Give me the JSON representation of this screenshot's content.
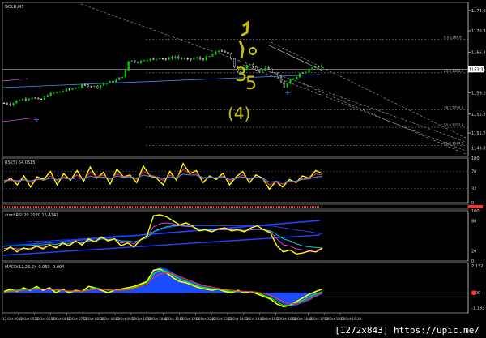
{
  "chart_data": [
    {
      "type": "candlestick",
      "title": "GOLD,M5",
      "y_ticks": [
        "1174.05",
        "1170.35",
        "1166.45",
        "1163.37",
        "1159.10",
        "1155.20",
        "1151.75",
        "1149.05"
      ],
      "ylim": [
        1147.5,
        1175.5
      ],
      "current_price": "1163.37",
      "levels": [
        {
          "label": "0.0 1168.8",
          "value": 1168.8
        },
        {
          "label": "23.6 1162.7",
          "value": 1162.7
        },
        {
          "label": "38.2 1156.0",
          "value": 1156.0
        },
        {
          "label": "50.0 1152.8",
          "value": 1152.8
        },
        {
          "label": "61.8 1149.5",
          "value": 1149.5
        }
      ],
      "price_path": [
        [
          0,
          1157.2
        ],
        [
          5,
          1157.0
        ],
        [
          10,
          1157.8
        ],
        [
          15,
          1158.0
        ],
        [
          20,
          1158.3
        ],
        [
          25,
          1157.6
        ],
        [
          30,
          1158.6
        ],
        [
          35,
          1159.0
        ],
        [
          40,
          1159.3
        ],
        [
          45,
          1159.6
        ],
        [
          50,
          1160.0
        ],
        [
          55,
          1160.3
        ],
        [
          60,
          1160.5
        ],
        [
          65,
          1160.1
        ],
        [
          70,
          1160.7
        ],
        [
          75,
          1161.0
        ],
        [
          80,
          1161.4
        ],
        [
          85,
          1162.4
        ],
        [
          88,
          1164.8
        ],
        [
          91,
          1165.0
        ],
        [
          95,
          1164.6
        ],
        [
          100,
          1165.3
        ],
        [
          105,
          1165.0
        ],
        [
          110,
          1165.5
        ],
        [
          115,
          1165.1
        ],
        [
          120,
          1165.7
        ],
        [
          125,
          1165.3
        ],
        [
          130,
          1165.0
        ],
        [
          135,
          1165.4
        ],
        [
          140,
          1165.2
        ],
        [
          145,
          1165.6
        ],
        [
          150,
          1166.4
        ],
        [
          153,
          1167.0
        ],
        [
          156,
          1166.3
        ],
        [
          160,
          1165.7
        ],
        [
          163,
          1163.8
        ],
        [
          166,
          1162.6
        ],
        [
          170,
          1163.3
        ],
        [
          173,
          1164.5
        ],
        [
          176,
          1164.0
        ],
        [
          180,
          1163.0
        ],
        [
          185,
          1163.4
        ],
        [
          190,
          1162.9
        ],
        [
          195,
          1161.7
        ],
        [
          198,
          1160.0
        ],
        [
          202,
          1161.2
        ],
        [
          206,
          1162.0
        ],
        [
          210,
          1162.6
        ],
        [
          215,
          1163.2
        ],
        [
          220,
          1163.6
        ],
        [
          225,
          1164.2
        ]
      ],
      "time_labels": [
        "12 Oct 2015",
        "12 Oct 05:20",
        "12 Oct 06:00",
        "12 Oct 06:40",
        "12 Oct 07:20",
        "12 Oct 08:00",
        "12 Oct 08:40",
        "12 Oct 09:20",
        "12 Oct 10:00",
        "12 Oct 10:40",
        "12 Oct 11:20",
        "12 Oct 12:00",
        "12 Oct 12:40",
        "12 Oct 13:20",
        "12 Oct 14:00",
        "12 Oct 14:40",
        "12 Oct 15:20",
        "12 Oct 16:00",
        "12 Oct 16:40",
        "12 Oct 17:20",
        "12 Oct 18:00",
        "12 Oct 19:20"
      ],
      "annotation_glyphs": [
        "3",
        "5",
        "4"
      ]
    },
    {
      "type": "line",
      "title": "RSI(5) 64.0615",
      "y_ticks": [
        "100",
        "70",
        "32",
        "0"
      ],
      "ylim": [
        0,
        100
      ],
      "series": [
        {
          "color": "#ffff00",
          "values": [
            45,
            55,
            40,
            60,
            35,
            58,
            52,
            70,
            40,
            65,
            50,
            72,
            48,
            80,
            55,
            68,
            42,
            75,
            58,
            62,
            45,
            82,
            60,
            55,
            40,
            70,
            50,
            88,
            65,
            72,
            45,
            60,
            52,
            66,
            40,
            58,
            70,
            45,
            62,
            55,
            30,
            48,
            35,
            52,
            45,
            60,
            55,
            72,
            65
          ]
        },
        {
          "color": "#ff3333",
          "values": [
            48,
            50,
            47,
            52,
            46,
            55,
            50,
            60,
            50,
            58,
            52,
            62,
            52,
            68,
            58,
            62,
            52,
            65,
            58,
            60,
            52,
            70,
            62,
            58,
            50,
            62,
            55,
            74,
            66,
            66,
            54,
            58,
            55,
            60,
            48,
            56,
            62,
            52,
            58,
            54,
            40,
            46,
            42,
            48,
            46,
            54,
            55,
            64,
            62
          ]
        },
        {
          "color": "#4a90ff",
          "values": [
            50,
            51,
            49,
            51,
            49,
            52,
            51,
            55,
            52,
            55,
            53,
            56,
            53,
            60,
            56,
            58,
            54,
            60,
            57,
            58,
            55,
            62,
            59,
            58,
            54,
            58,
            56,
            64,
            62,
            62,
            56,
            57,
            56,
            58,
            52,
            55,
            58,
            54,
            56,
            55,
            46,
            48,
            46,
            48,
            48,
            52,
            53,
            58,
            59
          ]
        }
      ]
    },
    {
      "type": "line",
      "title": "stochRSI 20.2020 15.4247",
      "y_ticks": [
        "100",
        "80",
        "20",
        "0"
      ],
      "ylim": [
        0,
        100
      ],
      "series": [
        {
          "color": "#ffff00",
          "values": [
            20,
            28,
            18,
            26,
            22,
            30,
            24,
            32,
            26,
            36,
            30,
            40,
            32,
            44,
            38,
            48,
            40,
            44,
            30,
            36,
            28,
            42,
            50,
            90,
            92,
            88,
            80,
            72,
            76,
            70,
            60,
            62,
            58,
            64,
            66,
            60,
            62,
            58,
            66,
            70,
            62,
            56,
            30,
            18,
            22,
            14,
            16,
            20,
            18,
            26
          ]
        },
        {
          "color": "#ff44ff",
          "values": [
            25,
            26,
            24,
            25,
            25,
            28,
            27,
            30,
            28,
            34,
            32,
            38,
            35,
            42,
            40,
            46,
            42,
            44,
            36,
            38,
            34,
            42,
            48,
            68,
            74,
            76,
            74,
            70,
            70,
            68,
            62,
            62,
            60,
            62,
            62,
            62,
            62,
            60,
            62,
            64,
            62,
            58,
            44,
            32,
            30,
            24,
            22,
            22,
            22,
            24
          ]
        },
        {
          "color": "#00e5e5",
          "values": [
            30,
            30,
            30,
            30,
            31,
            32,
            32,
            34,
            33,
            36,
            35,
            38,
            37,
            40,
            40,
            44,
            43,
            44,
            40,
            40,
            38,
            42,
            46,
            58,
            64,
            68,
            70,
            70,
            69,
            68,
            64,
            63,
            62,
            62,
            62,
            62,
            62,
            61,
            62,
            63,
            62,
            60,
            52,
            44,
            40,
            34,
            30,
            28,
            27,
            26
          ]
        },
        {
          "color": "#2244ff",
          "values": [
            38,
            38,
            38,
            38,
            39,
            39,
            40,
            40,
            41,
            42,
            42,
            43,
            44,
            45,
            46,
            47,
            48,
            49,
            50,
            50,
            51,
            52,
            54,
            58,
            62,
            66,
            68,
            70,
            70,
            70,
            70,
            70,
            70,
            70,
            70,
            70,
            70,
            70,
            70,
            70,
            70,
            70,
            68,
            66,
            64,
            62,
            60,
            58,
            56,
            54
          ]
        }
      ]
    },
    {
      "type": "bar",
      "title": "MACD(12,26,2) -0.059 -0.004",
      "y_ticks": [
        "2.132",
        "0.00",
        "-1.193"
      ],
      "ylim": [
        -1.6,
        2.4
      ],
      "histogram": [
        0.1,
        0.2,
        0.15,
        0.3,
        0.25,
        0.35,
        0.2,
        0.3,
        0.1,
        0.2,
        0.05,
        0.15,
        0.1,
        0.3,
        0.35,
        0.2,
        0.1,
        0.15,
        0.2,
        0.3,
        0.4,
        0.5,
        0.6,
        1.8,
        2.0,
        1.9,
        1.6,
        1.3,
        1.0,
        0.9,
        0.7,
        0.5,
        0.4,
        0.3,
        0.2,
        0.1,
        0.15,
        0.1,
        0.05,
        0.0,
        -0.1,
        -0.3,
        -0.6,
        -0.9,
        -1.1,
        -1.0,
        -0.8,
        -0.6,
        -0.3,
        -0.1
      ],
      "series": [
        {
          "color": "#ffff00",
          "values": [
            0.1,
            0.3,
            0.1,
            0.4,
            0.2,
            0.5,
            0.2,
            0.4,
            0.0,
            0.3,
            0.0,
            0.2,
            0.1,
            0.5,
            0.4,
            0.2,
            0.0,
            0.2,
            0.3,
            0.4,
            0.5,
            0.7,
            0.9,
            1.8,
            1.9,
            1.6,
            1.2,
            0.9,
            0.8,
            0.6,
            0.4,
            0.3,
            0.2,
            0.3,
            0.1,
            0.0,
            0.2,
            0.0,
            0.1,
            -0.1,
            -0.3,
            -0.5,
            -0.9,
            -1.1,
            -1.0,
            -0.7,
            -0.4,
            -0.1,
            0.1,
            0.3
          ]
        },
        {
          "color": "#00ff00",
          "values": [
            0.0,
            0.2,
            0.2,
            0.3,
            0.3,
            0.4,
            0.3,
            0.3,
            0.2,
            0.2,
            0.1,
            0.1,
            0.1,
            0.3,
            0.4,
            0.3,
            0.2,
            0.2,
            0.2,
            0.3,
            0.4,
            0.6,
            0.8,
            1.5,
            1.8,
            1.7,
            1.4,
            1.1,
            0.9,
            0.7,
            0.5,
            0.4,
            0.3,
            0.3,
            0.2,
            0.1,
            0.1,
            0.1,
            0.1,
            0.0,
            -0.2,
            -0.4,
            -0.7,
            -1.0,
            -1.0,
            -0.8,
            -0.6,
            -0.3,
            -0.1,
            0.1
          ]
        },
        {
          "color": "#ff3333",
          "values": [
            0.05,
            0.1,
            0.15,
            0.2,
            0.25,
            0.3,
            0.3,
            0.3,
            0.25,
            0.2,
            0.15,
            0.15,
            0.1,
            0.2,
            0.3,
            0.3,
            0.25,
            0.2,
            0.2,
            0.25,
            0.35,
            0.5,
            0.7,
            1.2,
            1.5,
            1.6,
            1.5,
            1.3,
            1.1,
            0.9,
            0.7,
            0.55,
            0.45,
            0.35,
            0.25,
            0.2,
            0.15,
            0.1,
            0.1,
            0.05,
            -0.05,
            -0.2,
            -0.45,
            -0.7,
            -0.85,
            -0.85,
            -0.7,
            -0.5,
            -0.25,
            0.0
          ]
        }
      ]
    }
  ],
  "watermark": "[1272x843] https://upic.me/"
}
